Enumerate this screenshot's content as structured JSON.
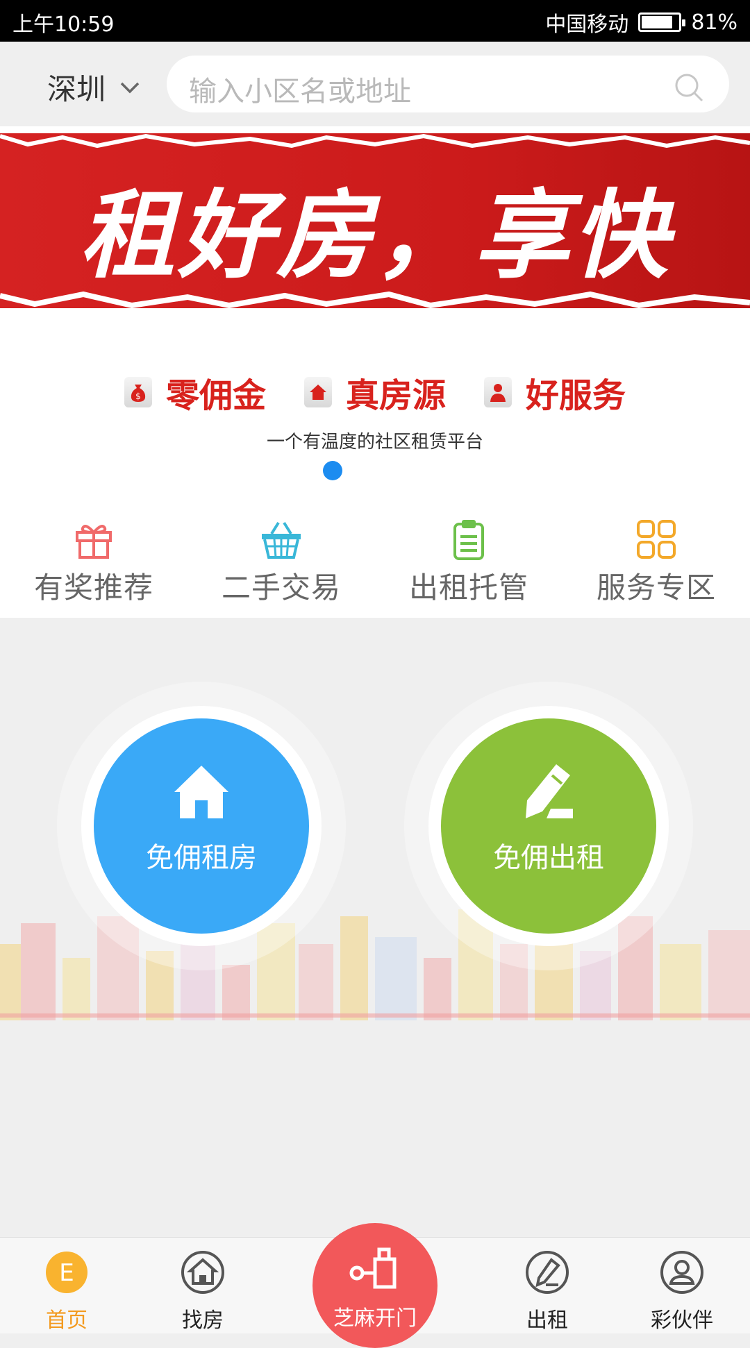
{
  "status_bar": {
    "time": "上午10:59",
    "carrier": "中国移动",
    "battery": "81%",
    "battery_level": 0.81
  },
  "header": {
    "city": "深圳",
    "search_placeholder": "输入小区名或地址"
  },
  "banner": {
    "slogan": "租好房，享快乐！"
  },
  "promo": {
    "features": [
      {
        "label": "零佣金",
        "icon": "money-bag-icon"
      },
      {
        "label": "真房源",
        "icon": "house-icon"
      },
      {
        "label": "好服务",
        "icon": "agent-icon"
      }
    ],
    "tagline": "一个有温度的社区租赁平台"
  },
  "quick": [
    {
      "label": "有奖推荐",
      "icon": "gift-icon",
      "color": "#f06a6a"
    },
    {
      "label": "二手交易",
      "icon": "basket-icon",
      "color": "#39b7d8"
    },
    {
      "label": "出租托管",
      "icon": "clipboard-icon",
      "color": "#6cc04a"
    },
    {
      "label": "服务专区",
      "icon": "grid-icon",
      "color": "#f3a829"
    }
  ],
  "actions": [
    {
      "label": "免佣租房",
      "icon": "home-icon",
      "color": "#3aa9f7"
    },
    {
      "label": "免佣出租",
      "icon": "edit-icon",
      "color": "#8cc13a"
    }
  ],
  "tabs": [
    {
      "label": "首页",
      "icon": "home-e-icon",
      "active": true
    },
    {
      "label": "找房",
      "icon": "house-outline-icon"
    },
    {
      "label": "芝麻开门",
      "icon": "key-icon"
    },
    {
      "label": "出租",
      "icon": "pen-icon"
    },
    {
      "label": "彩伙伴",
      "icon": "user-icon"
    }
  ],
  "colors": {
    "accent": "#f39a1e",
    "banner_red": "#d52222",
    "center_tab": "#f2585a",
    "dot": "#1c8cf0"
  }
}
